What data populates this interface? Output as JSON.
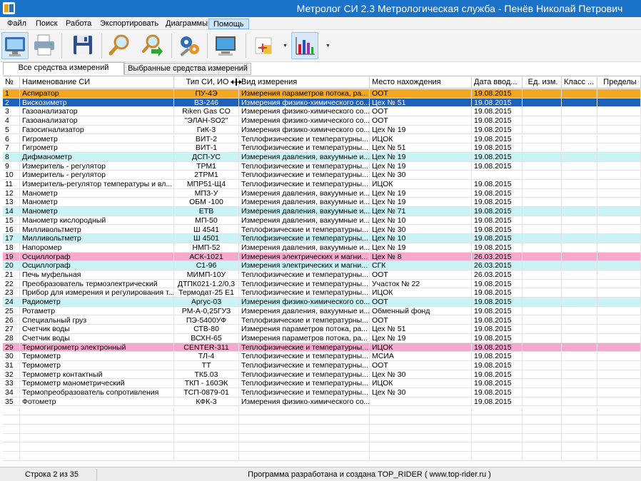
{
  "window": {
    "title": "Метролог СИ 2.3  Метрологическая служба - Пенёв Николай Петрович"
  },
  "menu": [
    "Файл",
    "Поиск",
    "Работа",
    "Экспортировать",
    "Диаграммы",
    "Помощь"
  ],
  "toolbar": {
    "buttons": [
      "monitor-icon",
      "printer-icon",
      "save-floppy-icon",
      "search-magnifier-icon",
      "search-next-icon",
      "settings-gears-icon",
      "computer-screen-icon",
      "chart-add-icon",
      "bar-chart-icon"
    ]
  },
  "tabs": [
    "Все средства измерений",
    "Выбранные средства измерений"
  ],
  "columns": [
    "№",
    "Наименование СИ",
    "Тип СИ, ИО",
    "Вид измерения",
    "Место нахождения",
    "Дата ввод...",
    "Ед. изм.",
    "Класс ...",
    "Пределы"
  ],
  "rows": [
    {
      "n": "1",
      "name": "Аспиратор",
      "type": "ПУ-4Э",
      "kind": "Измерения параметров потока, ра...",
      "place": "ООТ",
      "date": "19.08.2015",
      "style": "orange"
    },
    {
      "n": "2",
      "name": "Вискозиметр",
      "type": "ВЗ-246",
      "kind": "Измерения физико-химического со...",
      "place": "Цех № 51",
      "date": "19.08.2015",
      "style": "selected"
    },
    {
      "n": "3",
      "name": "Газоанализатор",
      "type": "Riken Gas  CO",
      "kind": "Измерения физико-химического со...",
      "place": "ООТ",
      "date": "19.08.2015",
      "style": "white"
    },
    {
      "n": "4",
      "name": "Газоанализатор",
      "type": "\"ЭЛАН-SO2\"",
      "kind": "Измерения физико-химического со...",
      "place": "ООТ",
      "date": "19.08.2015",
      "style": "white"
    },
    {
      "n": "5",
      "name": "Газосигнализатор",
      "type": "ГиК-3",
      "kind": "Измерения физико-химического со...",
      "place": "Цех № 19",
      "date": "19.08.2015",
      "style": "white"
    },
    {
      "n": "6",
      "name": "Гигрометр",
      "type": "ВИТ-2",
      "kind": "Теплофизические и температурны...",
      "place": "ИЦОК",
      "date": "19.08.2015",
      "style": "white"
    },
    {
      "n": "7",
      "name": "Гигрометр",
      "type": "ВИТ-1",
      "kind": "Теплофизические и температурны...",
      "place": "Цех № 51",
      "date": "19.08.2015",
      "style": "white"
    },
    {
      "n": "8",
      "name": "Дифманометр",
      "type": "ДСП-УС",
      "kind": "Измерения давления, вакуумные и...",
      "place": "Цех № 19",
      "date": "19.08.2015",
      "style": "cyan"
    },
    {
      "n": "9",
      "name": "Измеритель - регулятор",
      "type": "ТРМ1",
      "kind": "Теплофизические и температурны...",
      "place": "Цех № 19",
      "date": "19.08.2015",
      "style": "white"
    },
    {
      "n": "10",
      "name": "Измеритель - регулятор",
      "type": "2ТРМ1",
      "kind": "Теплофизические и температурны...",
      "place": "Цех № 30",
      "date": "",
      "style": "white"
    },
    {
      "n": "11",
      "name": "Измеритель-регулятор температуры и вл...",
      "type": "МПР51-Щ4",
      "kind": "Теплофизические и температурны...",
      "place": "ИЦОК",
      "date": "19.08.2015",
      "style": "white"
    },
    {
      "n": "12",
      "name": "Манометр",
      "type": "МПЗ-У",
      "kind": "Измерения давления, вакуумные и...",
      "place": "Цех № 19",
      "date": "19.08.2015",
      "style": "white"
    },
    {
      "n": "13",
      "name": "Манометр",
      "type": "ОБМ -100",
      "kind": "Измерения давления, вакуумные и...",
      "place": "Цех № 19",
      "date": "19.08.2015",
      "style": "white"
    },
    {
      "n": "14",
      "name": "Манометр",
      "type": "ЕТВ",
      "kind": "Измерения давления, вакуумные и...",
      "place": "Цех № 71",
      "date": "19.08.2015",
      "style": "cyan"
    },
    {
      "n": "15",
      "name": "Манометр кислородный",
      "type": "МП-50",
      "kind": "Измерения давления, вакуумные и...",
      "place": "Цех № 10",
      "date": "19.08.2015",
      "style": "white"
    },
    {
      "n": "16",
      "name": "Милливольтметр",
      "type": "Ш 4541",
      "kind": "Теплофизические и температурны...",
      "place": "Цех № 30",
      "date": "19.08.2015",
      "style": "white"
    },
    {
      "n": "17",
      "name": "Милливольтметр",
      "type": "Ш 4501",
      "kind": "Теплофизические и температурны...",
      "place": "Цех № 10",
      "date": "19.08.2015",
      "style": "cyan"
    },
    {
      "n": "18",
      "name": "Напоромер",
      "type": "НМП-52",
      "kind": "Измерения давления, вакуумные и...",
      "place": "Цех № 19",
      "date": "19.08.2015",
      "style": "white"
    },
    {
      "n": "19",
      "name": "Осциллограф",
      "type": "АСК-1021",
      "kind": "Измерения электрических и магни...",
      "place": "Цех № 8",
      "date": "26.03.2015",
      "style": "pink"
    },
    {
      "n": "20",
      "name": "Осциллограф",
      "type": "С1-96",
      "kind": "Измерения электрических и магни...",
      "place": "СГК",
      "date": "26.03.2015",
      "style": "cyan"
    },
    {
      "n": "21",
      "name": "Печь муфельная",
      "type": "МИМП-10У",
      "kind": "Теплофизические и температурны...",
      "place": "ООТ",
      "date": "26.03.2015",
      "style": "white"
    },
    {
      "n": "22",
      "name": "Преобразователь термоэлектрический",
      "type": "ДТПК021-1.2/0,3",
      "kind": "Теплофизические и температурны...",
      "place": "Участок № 22",
      "date": "19.08.2015",
      "style": "white"
    },
    {
      "n": "23",
      "name": "Прибор для измерения и регулирования т...",
      "type": "Термодат-25 Е1",
      "kind": "Теплофизические и температурны...",
      "place": "ИЦОК",
      "date": "19.08.2015",
      "style": "white"
    },
    {
      "n": "24",
      "name": "Радиометр",
      "type": "Аргус-03",
      "kind": "Измерения физико-химического со...",
      "place": "ООТ",
      "date": "19.08.2015",
      "style": "cyan"
    },
    {
      "n": "25",
      "name": "Ротаметр",
      "type": "РМ-А-0,25ГУЗ",
      "kind": "Измерения давления, вакуумные и...",
      "place": "Обменный фонд",
      "date": "19.08.2015",
      "style": "white"
    },
    {
      "n": "26",
      "name": "Специальный груз",
      "type": "ПЭ-5400УФ",
      "kind": "Теплофизические и температурны...",
      "place": "ООТ",
      "date": "19.08.2015",
      "style": "white"
    },
    {
      "n": "27",
      "name": "Счетчик воды",
      "type": "СТВ-80",
      "kind": "Измерения параметров потока, ра...",
      "place": "Цех № 51",
      "date": "19.08.2015",
      "style": "white"
    },
    {
      "n": "28",
      "name": "Счетчик воды",
      "type": "ВСХН-65",
      "kind": "Измерения параметров потока, ра...",
      "place": "Цех № 19",
      "date": "19.08.2015",
      "style": "white"
    },
    {
      "n": "29",
      "name": "Термогигрометр электронный",
      "type": "CENTER-311",
      "kind": "Теплофизические и температурны...",
      "place": "ИЦОК",
      "date": "19.08.2015",
      "style": "pink"
    },
    {
      "n": "30",
      "name": "Термометр",
      "type": "ТЛ-4",
      "kind": "Теплофизические и температурны...",
      "place": "МСИА",
      "date": "19.08.2015",
      "style": "white"
    },
    {
      "n": "31",
      "name": "Термометр",
      "type": "ТТ",
      "kind": "Теплофизические и температурны...",
      "place": "ООТ",
      "date": "19.08.2015",
      "style": "white"
    },
    {
      "n": "32",
      "name": "Термометр контактный",
      "type": "ТК5.03",
      "kind": "Теплофизические и температурны...",
      "place": "Цех № 30",
      "date": "19.08.2015",
      "style": "white"
    },
    {
      "n": "33",
      "name": "Термометр манометрический",
      "type": "ТКП - 160ЭК",
      "kind": "Теплофизические и температурны...",
      "place": "ИЦОК",
      "date": "19.08.2015",
      "style": "white"
    },
    {
      "n": "34",
      "name": "Термопреобразователь сопротивления",
      "type": "ТСП-0879-01",
      "kind": "Теплофизические и температурны...",
      "place": "Цех № 30",
      "date": "19.08.2015",
      "style": "white"
    },
    {
      "n": "35",
      "name": "Фотометр",
      "type": "КФК-3",
      "kind": "Измерения физико-химического со...",
      "place": "",
      "date": "19.08.2015",
      "style": "white"
    }
  ],
  "status": {
    "left": "Строка 2 из 35",
    "right": "Программа разработана и создана  TOP_RIDER ( www.top-rider.ru )"
  },
  "colors": {
    "title_bar": "#1a72c9",
    "orange_row": "#f5a623",
    "selected_row": "#1f5fb8",
    "cyan_row": "#c9f3f5",
    "pink_row": "#f7a9cd"
  }
}
